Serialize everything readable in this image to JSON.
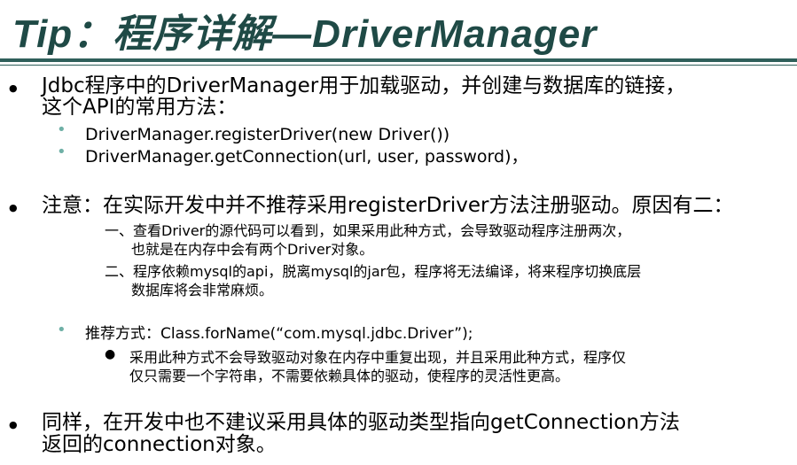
{
  "title": "Tip：程序详解—DriverManager",
  "item1": {
    "line1": "Jdbc程序中的DriverManager用于加载驱动，并创建与数据库的链接，",
    "line2": "这个API的常用方法：",
    "sub": [
      "DriverManager.registerDriver(new Driver())",
      "DriverManager.getConnection(url, user, password)，"
    ]
  },
  "item2": {
    "line1": "注意：在实际开发中并不推荐采用registerDriver方法注册驱动。原因有二：",
    "reasons": [
      {
        "line1": "一、查看Driver的源代码可以看到，如果采用此种方式，会导致驱动程序注册两次，",
        "line2": "也就是在内存中会有两个Driver对象。"
      },
      {
        "line1": "二、程序依赖mysql的api，脱离mysql的jar包，程序将无法编译，将来程序切换底层",
        "line2": "数据库将会非常麻烦。"
      }
    ],
    "recommend": "推荐方式：Class.forName(“com.mysql.jdbc.Driver”);",
    "recommend_detail": {
      "line1": "采用此种方式不会导致驱动对象在内存中重复出现，并且采用此种方式，程序仅",
      "line2": "仅只需要一个字符串，不需要依赖具体的驱动，使程序的灵活性更高。"
    }
  },
  "item3": {
    "line1": "同样，在开发中也不建议采用具体的驱动类型指向getConnection方法",
    "line2": "返回的connection对象。"
  }
}
